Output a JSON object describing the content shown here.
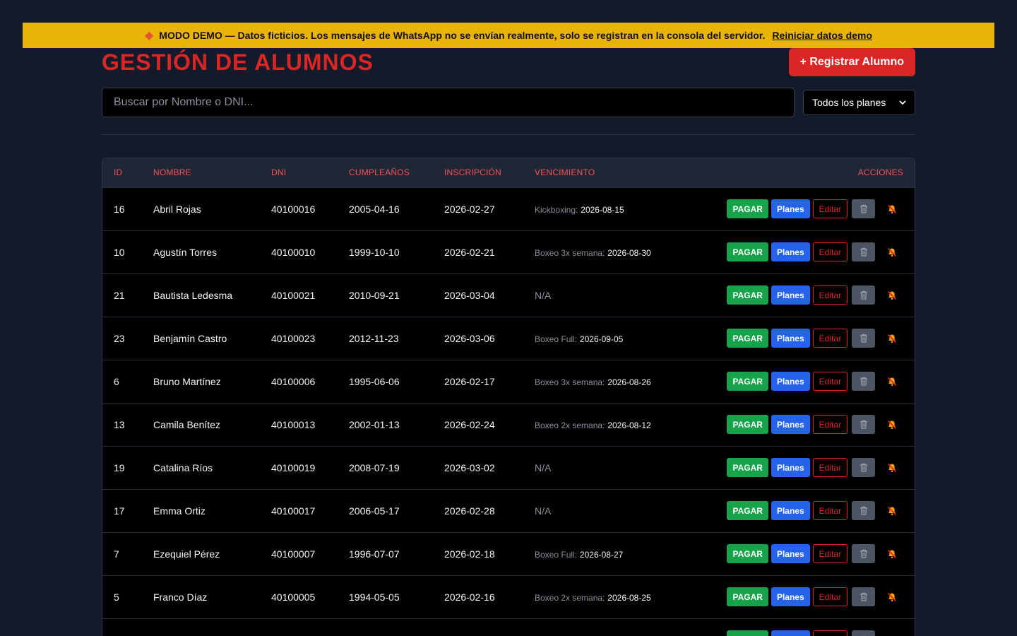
{
  "banner": {
    "text": "MODO DEMO — Datos ficticios. Los mensajes de WhatsApp no se envían realmente, solo se registran en la consola del servidor.",
    "link": "Reiniciar datos demo"
  },
  "header": {
    "title": "GESTIÓN DE ALUMNOS",
    "register_label": "+ Registrar Alumno"
  },
  "filters": {
    "search_placeholder": "Buscar por Nombre o DNI...",
    "plan_selected": "Todos los planes"
  },
  "table": {
    "columns": [
      "ID",
      "NOMBRE",
      "DNI",
      "CUMPLEAÑOS",
      "INSCRIPCIÓN",
      "VENCIMIENTO",
      "ACCIONES"
    ],
    "actions": {
      "pay": "PAGAR",
      "plans": "Planes",
      "edit": "Editar"
    },
    "rows": [
      {
        "id": "16",
        "name": "Abril Rojas",
        "dni": "40100016",
        "birthday": "2005-04-16",
        "signup": "2026-02-27",
        "plan": "Kickboxing:",
        "due": "2026-08-15"
      },
      {
        "id": "10",
        "name": "Agustín Torres",
        "dni": "40100010",
        "birthday": "1999-10-10",
        "signup": "2026-02-21",
        "plan": "Boxeo 3x semana:",
        "due": "2026-08-30"
      },
      {
        "id": "21",
        "name": "Bautista Ledesma",
        "dni": "40100021",
        "birthday": "2010-09-21",
        "signup": "2026-03-04",
        "plan": "",
        "due": "N/A"
      },
      {
        "id": "23",
        "name": "Benjamín Castro",
        "dni": "40100023",
        "birthday": "2012-11-23",
        "signup": "2026-03-06",
        "plan": "Boxeo Full:",
        "due": "2026-09-05"
      },
      {
        "id": "6",
        "name": "Bruno Martínez",
        "dni": "40100006",
        "birthday": "1995-06-06",
        "signup": "2026-02-17",
        "plan": "Boxeo 3x semana:",
        "due": "2026-08-26"
      },
      {
        "id": "13",
        "name": "Camila Benítez",
        "dni": "40100013",
        "birthday": "2002-01-13",
        "signup": "2026-02-24",
        "plan": "Boxeo 2x semana:",
        "due": "2026-08-12"
      },
      {
        "id": "19",
        "name": "Catalina Ríos",
        "dni": "40100019",
        "birthday": "2008-07-19",
        "signup": "2026-03-02",
        "plan": "",
        "due": "N/A"
      },
      {
        "id": "17",
        "name": "Emma Ortiz",
        "dni": "40100017",
        "birthday": "2006-05-17",
        "signup": "2026-02-28",
        "plan": "",
        "due": "N/A"
      },
      {
        "id": "7",
        "name": "Ezequiel Pérez",
        "dni": "40100007",
        "birthday": "1996-07-07",
        "signup": "2026-02-18",
        "plan": "Boxeo Full:",
        "due": "2026-08-27"
      },
      {
        "id": "5",
        "name": "Franco Díaz",
        "dni": "40100005",
        "birthday": "1994-05-05",
        "signup": "2026-02-16",
        "plan": "Boxeo 2x semana:",
        "due": "2026-08-25"
      },
      {
        "id": "",
        "name": "",
        "dni": "",
        "birthday": "",
        "signup": "",
        "plan": "",
        "due": ""
      }
    ]
  },
  "icons": {
    "warning": "diamond-icon",
    "delete": "trash-icon",
    "notify": "bell-off-icon",
    "select": "chevron-down-icon"
  }
}
